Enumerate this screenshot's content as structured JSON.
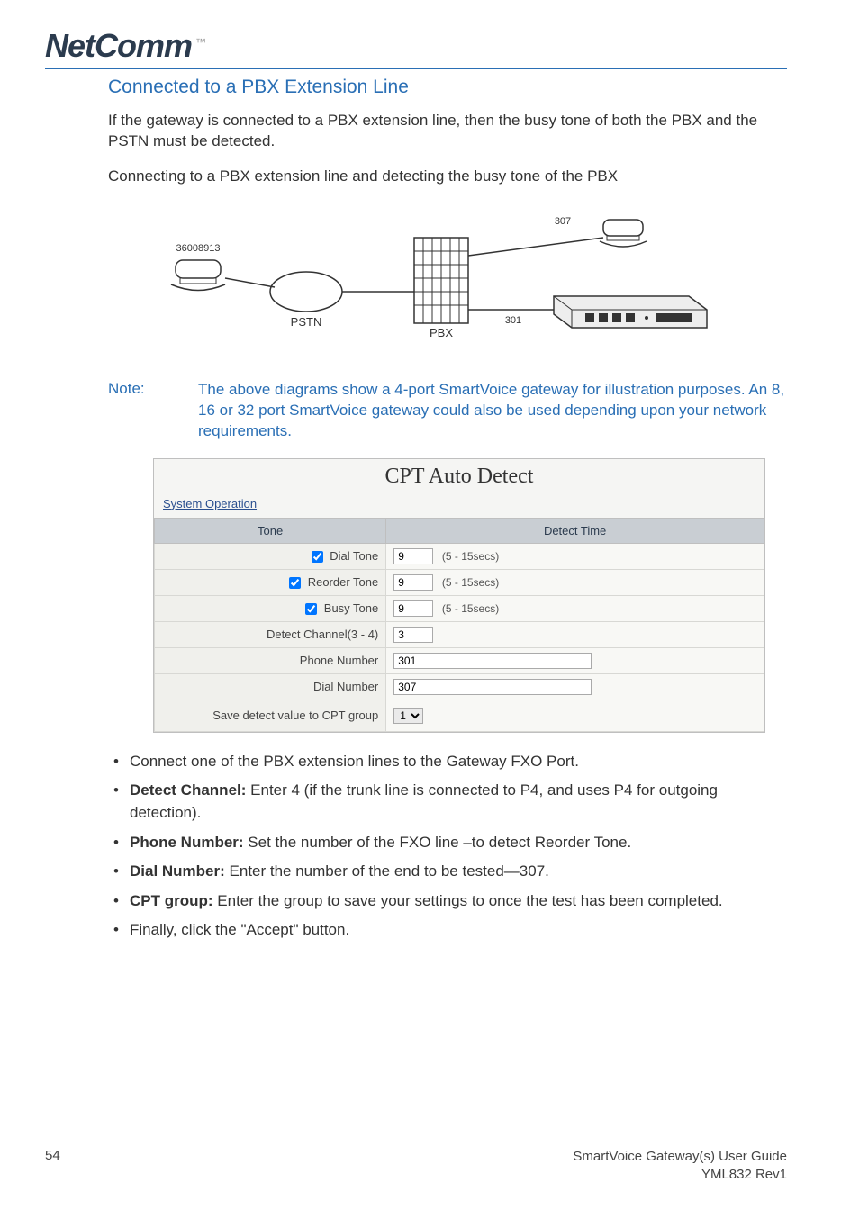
{
  "brand": {
    "name": "NetComm",
    "tm": "™"
  },
  "section": {
    "title": "Connected to a PBX Extension Line",
    "para1": "If the gateway is connected to a PBX extension line, then the busy tone of both the PBX and the PSTN must be detected.",
    "para2": "Connecting to a PBX extension line and detecting the busy tone of the PBX"
  },
  "diagram": {
    "ext_left": "36008913",
    "pstn": "PSTN",
    "pbx": "PBX",
    "ext_301": "301",
    "ext_307": "307"
  },
  "note": {
    "label": "Note:",
    "text": "The above diagrams show a 4-port SmartVoice gateway for illustration purposes. An 8, 16 or 32 port SmartVoice gateway could also be used depending upon your network requirements."
  },
  "cpt": {
    "title": "CPT Auto Detect",
    "link": "System Operation",
    "col_tone": "Tone",
    "col_detect": "Detect Time",
    "rows": {
      "dial": {
        "label": "Dial Tone",
        "value": "9",
        "hint": "(5 - 15secs)"
      },
      "reorder": {
        "label": "Reorder Tone",
        "value": "9",
        "hint": "(5 - 15secs)"
      },
      "busy": {
        "label": "Busy Tone",
        "value": "9",
        "hint": "(5 - 15secs)"
      }
    },
    "detect_channel": {
      "label": "Detect Channel(3 - 4)",
      "value": "3"
    },
    "phone_number": {
      "label": "Phone Number",
      "value": "301"
    },
    "dial_number": {
      "label": "Dial Number",
      "value": "307"
    },
    "save": {
      "label": "Save detect value to CPT group",
      "value": "1"
    }
  },
  "bullets": {
    "b1": "Connect one of the PBX extension lines to the Gateway FXO Port.",
    "b2_label": "Detect Channel:",
    "b2_text": " Enter 4 (if the trunk line is connected to P4, and uses P4 for outgoing detection).",
    "b3_label": "Phone Number:",
    "b3_text": " Set the number of the FXO line –to detect Reorder Tone.",
    "b4_label": "Dial Number:",
    "b4_text": " Enter the number of the end to be tested—307.",
    "b5_label": "CPT group:",
    "b5_text": " Enter the group to save your settings to once the test has been completed.",
    "b6": "Finally, click the \"Accept\" button."
  },
  "footer": {
    "page": "54",
    "guide": "SmartVoice Gateway(s) User Guide",
    "doc": "YML832 Rev1"
  }
}
